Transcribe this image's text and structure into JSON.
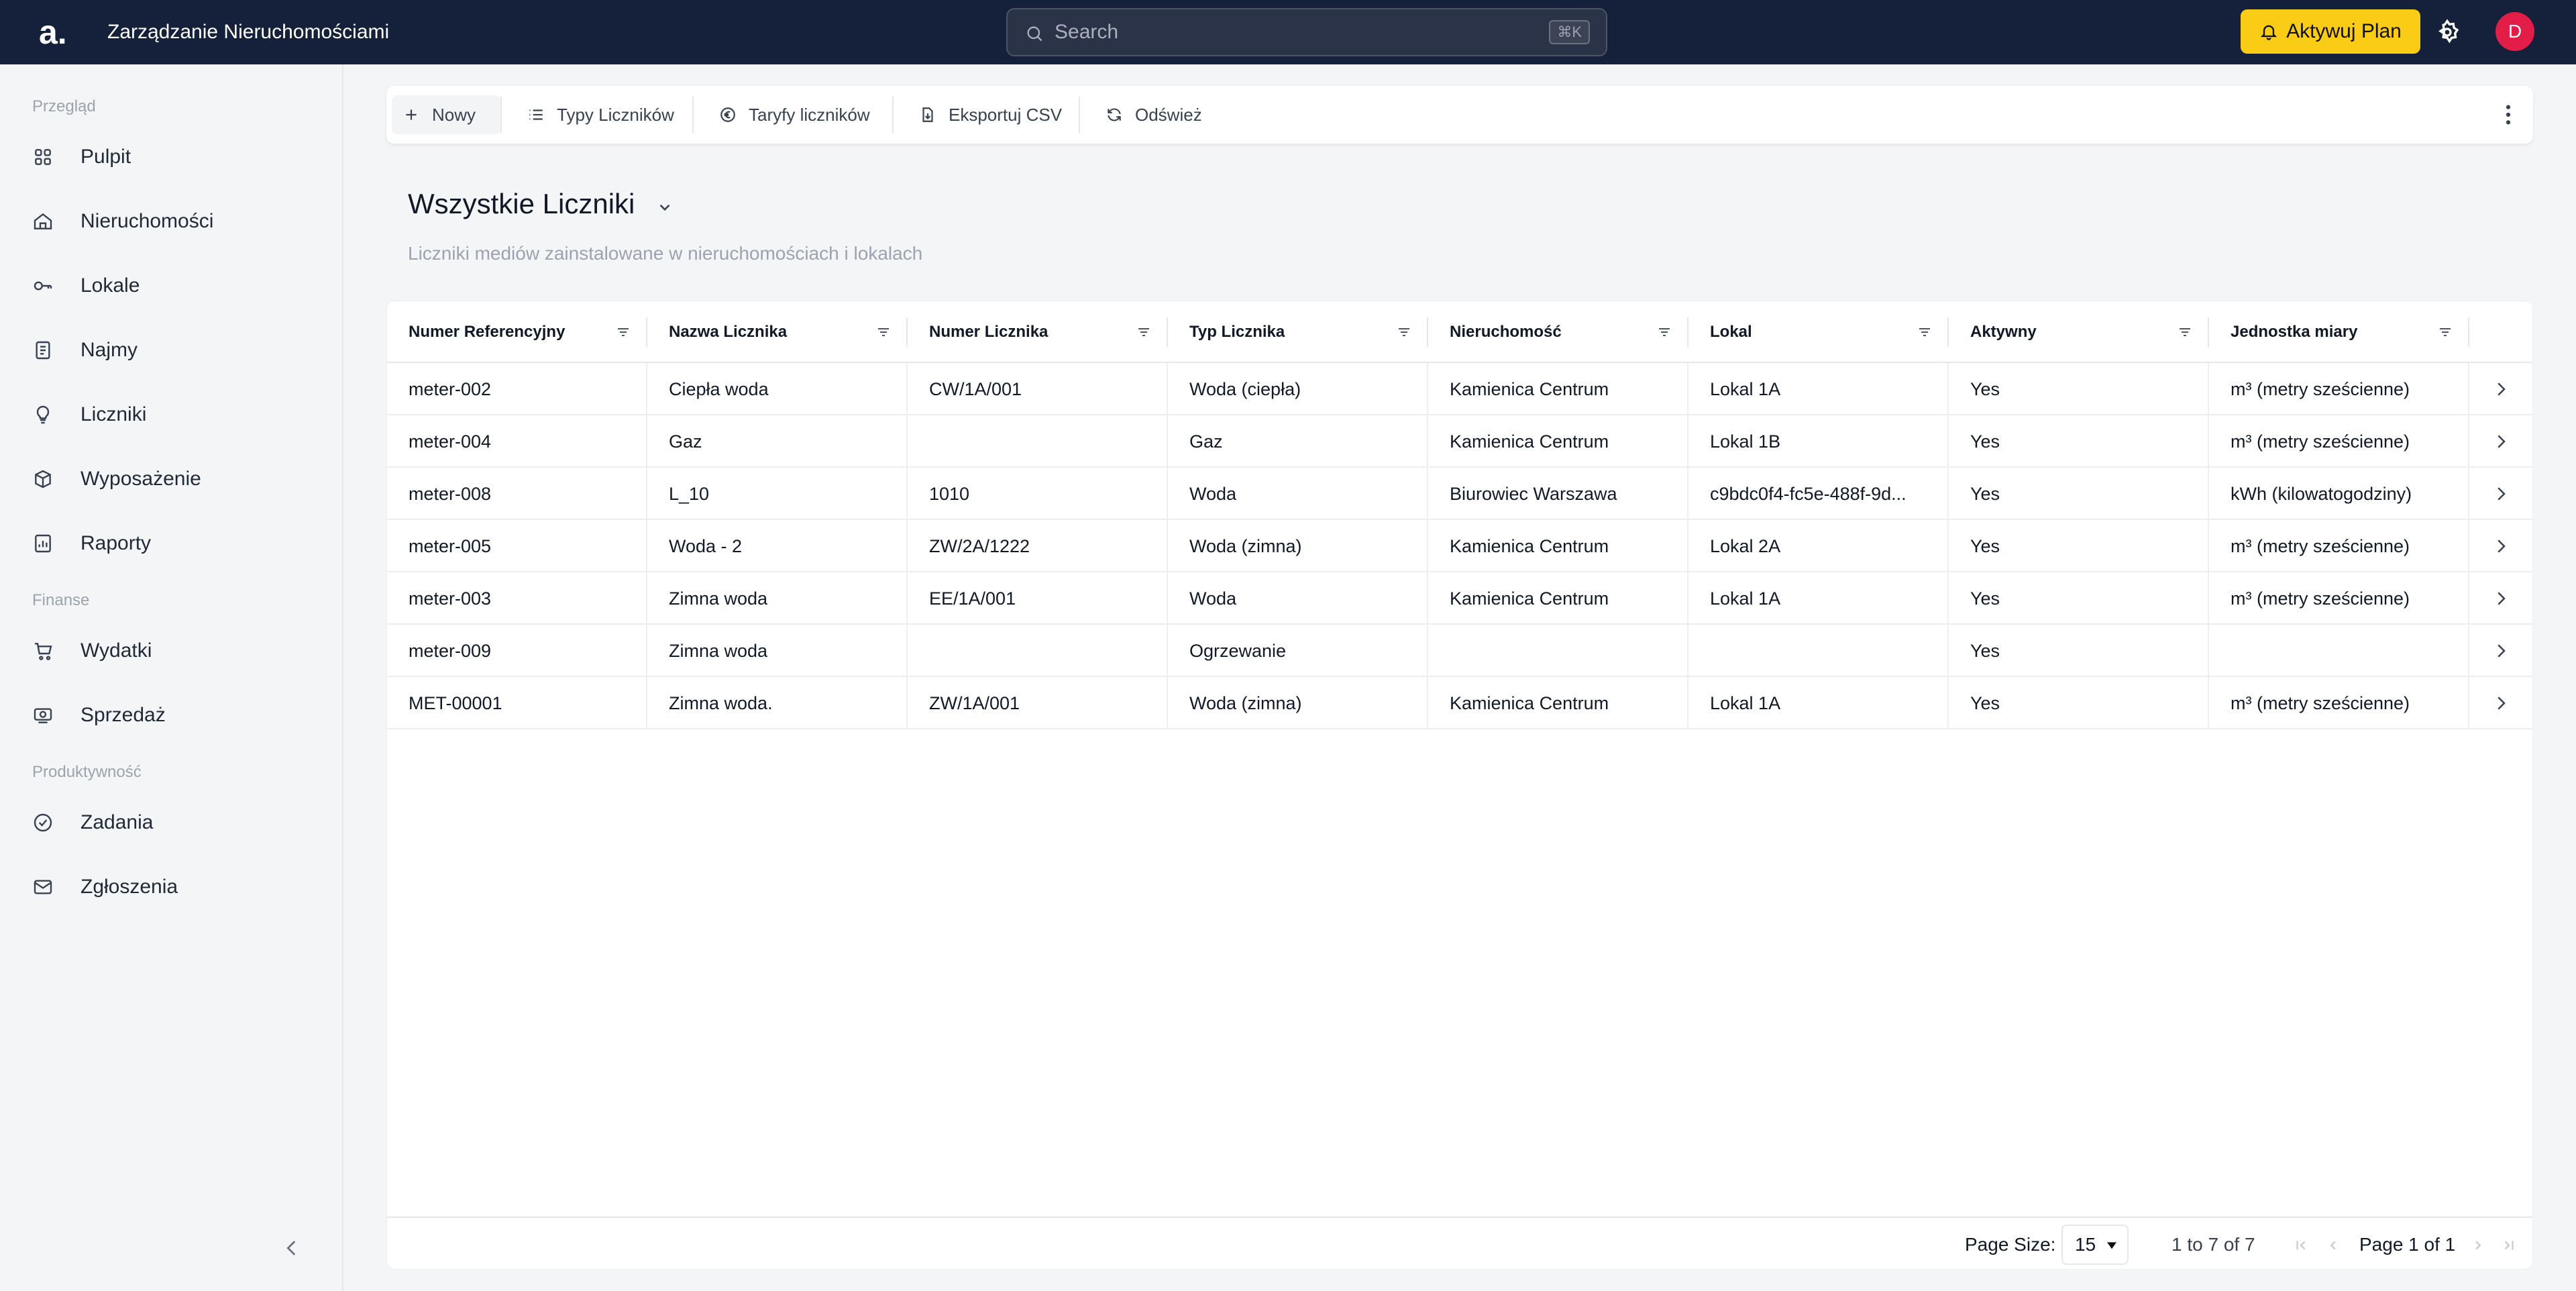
{
  "app": {
    "logo": "a.",
    "title": "Zarządzanie Nieruchomościami",
    "search_placeholder": "Search",
    "search_shortcut": "⌘K",
    "upgrade_label": "Aktywuj Plan",
    "avatar_initial": "D",
    "brand_color": "#15213a",
    "accent_color": "#facc15",
    "avatar_color": "#e11d48"
  },
  "sidebar": {
    "sections": [
      {
        "label": "Przegląd"
      },
      {
        "label": "Finanse"
      },
      {
        "label": "Produktywność"
      }
    ],
    "items": [
      {
        "label": "Pulpit",
        "icon": "grid-icon"
      },
      {
        "label": "Nieruchomości",
        "icon": "building-icon"
      },
      {
        "label": "Lokale",
        "icon": "key-icon"
      },
      {
        "label": "Najmy",
        "icon": "document-icon"
      },
      {
        "label": "Liczniki",
        "icon": "lightbulb-icon"
      },
      {
        "label": "Wyposażenie",
        "icon": "box-icon"
      },
      {
        "label": "Raporty",
        "icon": "report-icon"
      },
      {
        "label": "Wydatki",
        "icon": "cart-icon"
      },
      {
        "label": "Sprzedaż",
        "icon": "cash-icon"
      },
      {
        "label": "Zadania",
        "icon": "check-circle-icon"
      },
      {
        "label": "Zgłoszenia",
        "icon": "mail-icon"
      }
    ]
  },
  "toolbar": {
    "new_label": "Nowy",
    "types_label": "Typy Liczników",
    "tariffs_label": "Taryfy liczników",
    "export_label": "Eksportuj CSV",
    "refresh_label": "Odśwież"
  },
  "page": {
    "title": "Wszystkie Liczniki",
    "subtitle": "Liczniki mediów zainstalowane w nieruchomościach i lokalach"
  },
  "table": {
    "columns": [
      "Numer Referencyjny",
      "Nazwa Licznika",
      "Numer Licznika",
      "Typ Licznika",
      "Nieruchomość",
      "Lokal",
      "Aktywny",
      "Jednostka miary"
    ],
    "rows": [
      [
        "meter-002",
        "Ciepła woda",
        "CW/1A/001",
        "Woda (ciepła)",
        "Kamienica Centrum",
        "Lokal 1A",
        "Yes",
        "m³ (metry sześcienne)"
      ],
      [
        "meter-004",
        "Gaz",
        "",
        "Gaz",
        "Kamienica Centrum",
        "Lokal 1B",
        "Yes",
        "m³ (metry sześcienne)"
      ],
      [
        "meter-008",
        "L_10",
        "1010",
        "Woda",
        "Biurowiec Warszawa",
        "c9bdc0f4-fc5e-488f-9d...",
        "Yes",
        "kWh (kilowatogodziny)"
      ],
      [
        "meter-005",
        "Woda - 2",
        "ZW/2A/1222",
        "Woda (zimna)",
        "Kamienica Centrum",
        "Lokal 2A",
        "Yes",
        "m³ (metry sześcienne)"
      ],
      [
        "meter-003",
        "Zimna woda",
        "EE/1A/001",
        "Woda",
        "Kamienica Centrum",
        "Lokal 1A",
        "Yes",
        "m³ (metry sześcienne)"
      ],
      [
        "meter-009",
        "Zimna woda",
        "",
        "Ogrzewanie",
        "",
        "",
        "Yes",
        ""
      ],
      [
        "MET-00001",
        "Zimna woda.",
        "ZW/1A/001",
        "Woda (zimna)",
        "Kamienica Centrum",
        "Lokal 1A",
        "Yes",
        "m³ (metry sześcienne)"
      ]
    ]
  },
  "pagination": {
    "page_size_label": "Page Size:",
    "page_size": "15",
    "range": "1 to 7 of 7",
    "page_of": "Page 1 of 1"
  }
}
